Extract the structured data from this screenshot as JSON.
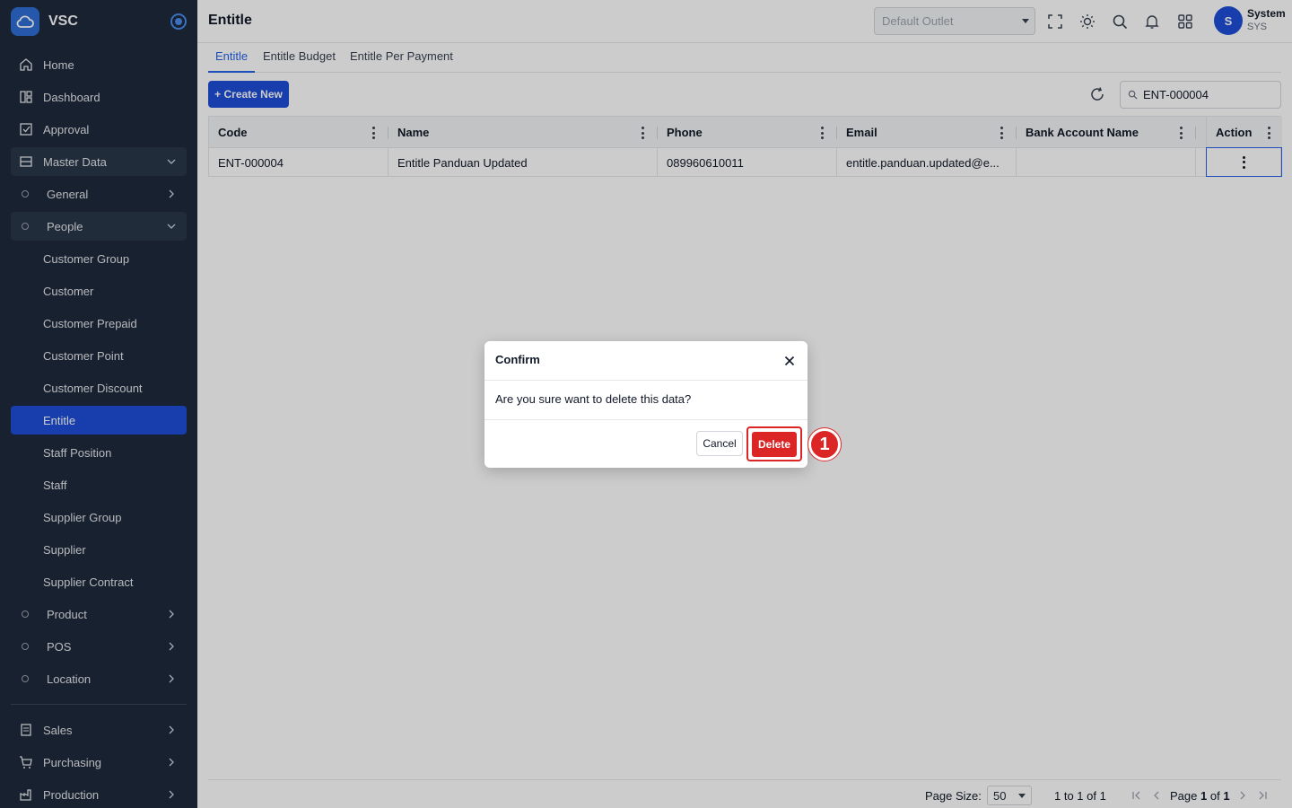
{
  "brand": {
    "name": "VSC"
  },
  "sidebar": {
    "items": [
      {
        "label": "Home",
        "icon": "home-icon"
      },
      {
        "label": "Dashboard",
        "icon": "dashboard-icon"
      },
      {
        "label": "Approval",
        "icon": "approval-icon"
      },
      {
        "label": "Master Data",
        "icon": "master-data-icon"
      },
      {
        "label": "General"
      },
      {
        "label": "People"
      },
      {
        "label": "Customer Group"
      },
      {
        "label": "Customer"
      },
      {
        "label": "Customer Prepaid"
      },
      {
        "label": "Customer Point"
      },
      {
        "label": "Customer Discount"
      },
      {
        "label": "Entitle"
      },
      {
        "label": "Staff Position"
      },
      {
        "label": "Staff"
      },
      {
        "label": "Supplier Group"
      },
      {
        "label": "Supplier"
      },
      {
        "label": "Supplier Contract"
      },
      {
        "label": "Product"
      },
      {
        "label": "POS"
      },
      {
        "label": "Location"
      },
      {
        "label": "Sales",
        "icon": "sales-icon"
      },
      {
        "label": "Purchasing",
        "icon": "cart-icon"
      },
      {
        "label": "Production",
        "icon": "production-icon"
      }
    ],
    "active_color": "#1d4ed8"
  },
  "header": {
    "title": "Entitle",
    "outlet_placeholder": "Default Outlet",
    "user_initial": "S",
    "user_name": "System",
    "user_code": "SYS"
  },
  "tabs": [
    {
      "label": "Entitle",
      "active": true
    },
    {
      "label": "Entitle Budget"
    },
    {
      "label": "Entitle Per Payment"
    }
  ],
  "toolbar": {
    "create_label": "+ Create New",
    "search_value": "ENT-000004"
  },
  "grid": {
    "columns": [
      "Code",
      "Name",
      "Phone",
      "Email",
      "Bank Account Name",
      "Action"
    ],
    "rows": [
      [
        "ENT-000004",
        "Entitle Panduan Updated",
        "089960610011",
        "entitle.panduan.updated@e...",
        ""
      ]
    ]
  },
  "footer": {
    "page_size_label": "Page Size:",
    "page_size": "50",
    "range": "1 to 1 of 1",
    "page_prefix": "Page",
    "page_current": "1",
    "page_of": "of",
    "page_total": "1"
  },
  "modal": {
    "title": "Confirm",
    "message": "Are you sure want to delete this data?",
    "cancel_label": "Cancel",
    "delete_label": "Delete",
    "danger_color": "#dc2626"
  },
  "annotation": {
    "step": "1"
  }
}
